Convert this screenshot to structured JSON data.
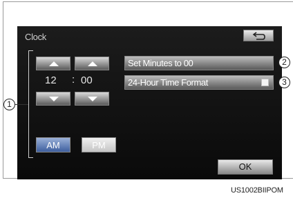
{
  "screen": {
    "title": "Clock",
    "back_icon": "return-arrow-icon"
  },
  "clock": {
    "hour": "12",
    "separator": ":",
    "minute": "00",
    "hour_up_icon": "triangle-up-icon",
    "hour_down_icon": "triangle-down-icon",
    "minute_up_icon": "triangle-up-icon",
    "minute_down_icon": "triangle-down-icon",
    "am_label": "AM",
    "pm_label": "PM",
    "selected_period": "AM"
  },
  "options": {
    "set_minutes_label": "Set Minutes to 00",
    "format_label": "24-Hour Time Format",
    "format_enabled": false
  },
  "ok_label": "OK",
  "callouts": {
    "one": "1",
    "two": "2",
    "three": "3"
  },
  "caption": "US1002BIIPOM",
  "colors": {
    "screen_bg": "#111111",
    "am_active": "#3e5f9e",
    "button_gray": "#8a8a8a"
  }
}
